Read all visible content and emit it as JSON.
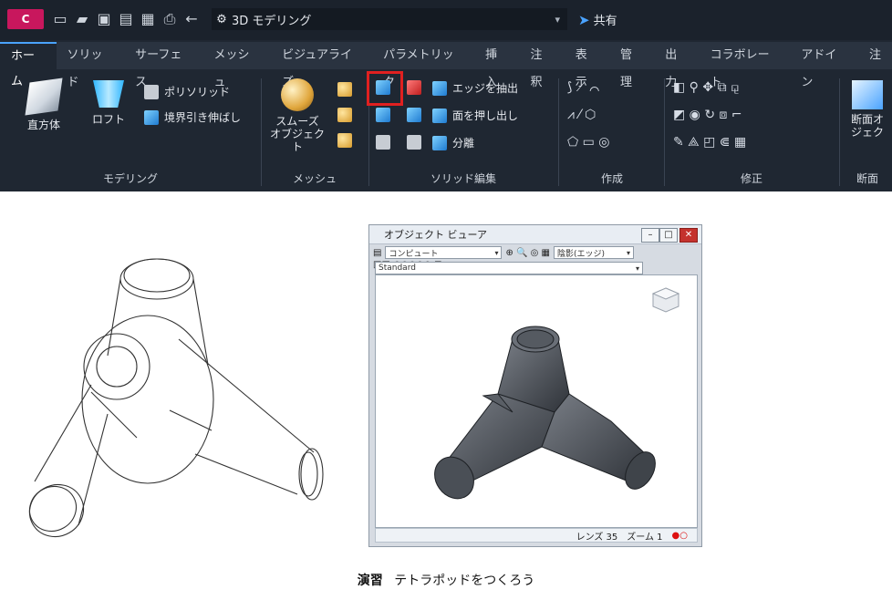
{
  "app": {
    "logo_text": "C",
    "workspace": "3D モデリング",
    "share": "共有"
  },
  "tabs": [
    "ホーム",
    "ソリッド",
    "サーフェス",
    "メッシュ",
    "ビジュアライズ",
    "パラメトリック",
    "挿入",
    "注釈",
    "表示",
    "管理",
    "出力",
    "コラボレート",
    "アドイン",
    "注"
  ],
  "ribbon": {
    "modeling": {
      "label": "モデリング",
      "box": "直方体",
      "loft": "ロフト",
      "polysolid": "ポリソリッド",
      "presspull": "境界引き伸ばし"
    },
    "mesh": {
      "label": "メッシュ",
      "smooth_object": "スムーズ\nオブジェクト"
    },
    "solid_edit": {
      "label": "ソリッド編集",
      "extract_edges": "エッジを抽出",
      "extrude_faces": "面を押し出し",
      "separate": "分離"
    },
    "draw": {
      "label": "作成"
    },
    "modify": {
      "label": "修正"
    },
    "section": {
      "label": "断面",
      "section_plane": "断面オ\nジェク"
    }
  },
  "viewer": {
    "title": "オブジェクト ビューア",
    "view_select": "コンピュート",
    "style_select": "陰影(エッジ)",
    "ucs_select": "Standard",
    "status_left": "レンズ 35",
    "status_right": "ズーム 1"
  },
  "caption": {
    "label": "演習",
    "text": "テトラポッドをつくろう"
  },
  "colors": {
    "ribbon_bg": "#1f2732",
    "highlight": "#e02020",
    "accent": "#4aa3ff"
  }
}
